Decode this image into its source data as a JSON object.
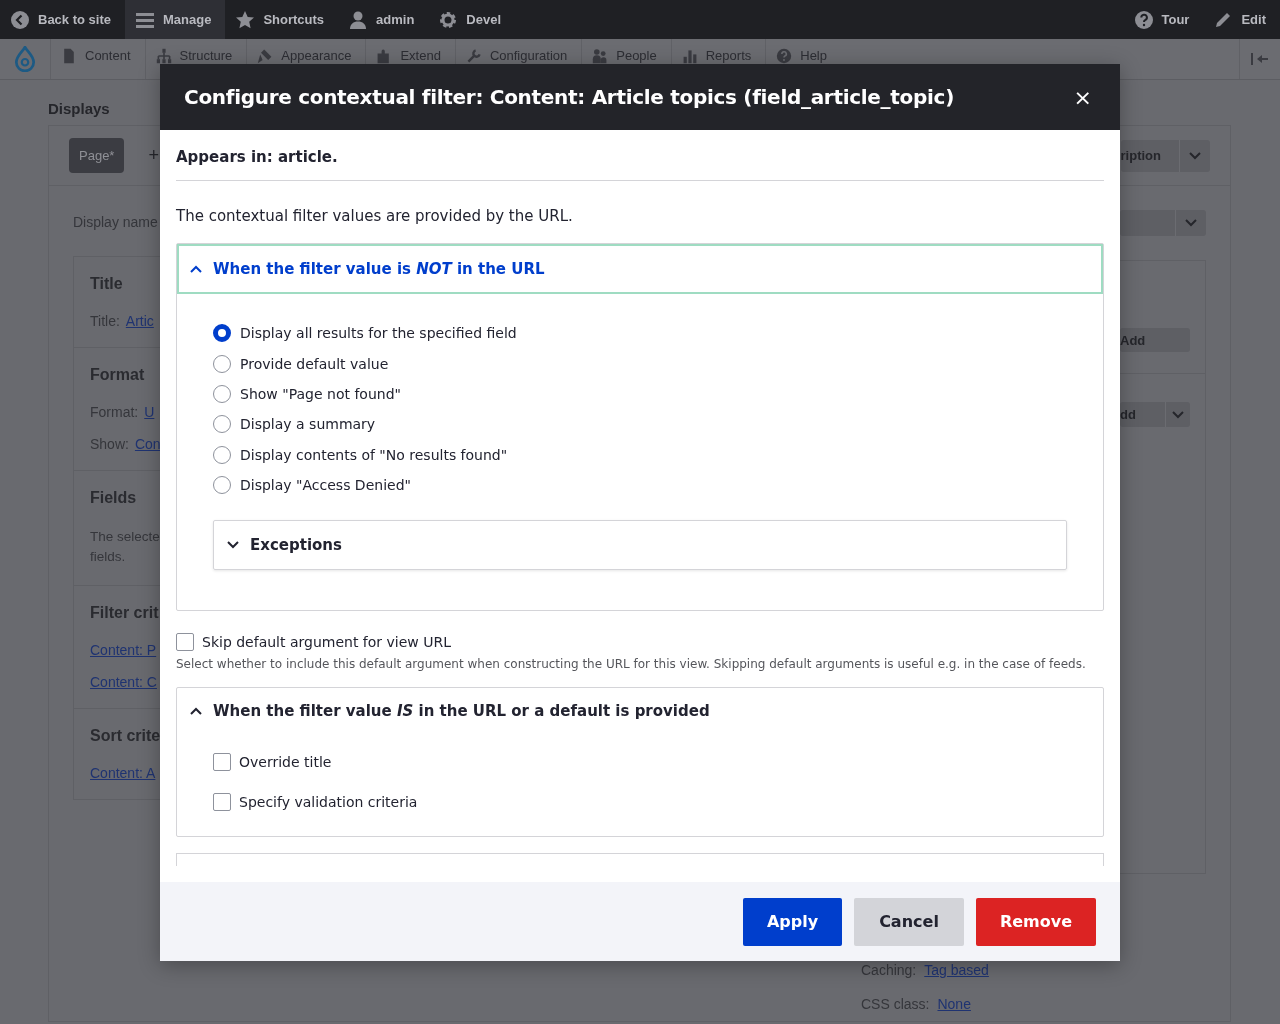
{
  "toolbar": {
    "left": [
      {
        "kind": "back",
        "label": "Back to site",
        "selected": false
      },
      {
        "kind": "menu",
        "label": "Manage",
        "selected": true
      },
      {
        "kind": "star",
        "label": "Shortcuts",
        "selected": false
      },
      {
        "kind": "user",
        "label": "admin",
        "selected": false
      },
      {
        "kind": "gear",
        "label": "Devel",
        "selected": false
      }
    ],
    "right": [
      {
        "kind": "help",
        "label": "Tour"
      },
      {
        "kind": "pencil",
        "label": "Edit"
      }
    ]
  },
  "admin_menu": {
    "items": [
      {
        "kind": "page",
        "label": "Content"
      },
      {
        "kind": "structure",
        "label": "Structure"
      },
      {
        "kind": "brush",
        "label": "Appearance"
      },
      {
        "kind": "puzzle",
        "label": "Extend"
      },
      {
        "kind": "wrench",
        "label": "Configuration"
      },
      {
        "kind": "people",
        "label": "People"
      },
      {
        "kind": "chart",
        "label": "Reports"
      },
      {
        "kind": "help",
        "label": "Help"
      }
    ]
  },
  "page": {
    "heading": "Displays",
    "display_tabs": [
      {
        "label": "Page*",
        "selected": true
      }
    ],
    "add_display": "+",
    "top_dropdown": "ription",
    "display_name_label": "Display name",
    "sections": [
      {
        "title": "Title",
        "lines": [
          {
            "label": "Title:",
            "link": "Artic"
          }
        ]
      },
      {
        "title": "Format",
        "lines": [
          {
            "label": "Format:",
            "link": "U"
          },
          {
            "label": "Show:",
            "link": "Con"
          }
        ]
      },
      {
        "title": "Fields",
        "text": "The selecte\nfields."
      },
      {
        "title": "Filter crit",
        "lines": [
          {
            "link": "Content: P"
          },
          {
            "link": "Content: C"
          }
        ]
      },
      {
        "title": "Sort crite",
        "lines": [
          {
            "link": "Content: A"
          }
        ]
      }
    ],
    "right_add_button": "Add",
    "right_dropdown": "dd",
    "settings": [
      {
        "label": "Caching:",
        "link": "Tag based"
      },
      {
        "label": "CSS class:",
        "link": "None"
      }
    ]
  },
  "dialog": {
    "title": "Configure contextual filter: Content: Article topics (field_article_topic)",
    "close": "×",
    "appears_in": "Appears in: article.",
    "intro": "The contextual filter values are provided by the URL.",
    "not_in_url": {
      "title": "When the filter value is *NOT* in the URL",
      "expanded": true,
      "focused": true,
      "options": [
        {
          "label": "Display all results for the specified field",
          "selected": true
        },
        {
          "label": "Provide default value",
          "selected": false
        },
        {
          "label": "Show \"Page not found\"",
          "selected": false
        },
        {
          "label": "Display a summary",
          "selected": false
        },
        {
          "label": "Display contents of \"No results found\"",
          "selected": false
        },
        {
          "label": "Display \"Access Denied\"",
          "selected": false
        }
      ],
      "exceptions": {
        "title": "Exceptions",
        "expanded": false
      }
    },
    "skip_default": {
      "label": "Skip default argument for view URL",
      "checked": false,
      "description": "Select whether to include this default argument when constructing the URL for this view. Skipping default arguments is useful e.g. in the case of feeds."
    },
    "in_url": {
      "title": "When the filter value *IS* in the URL or a default is provided",
      "expanded": true,
      "options": [
        {
          "label": "Override title",
          "checked": false
        },
        {
          "label": "Specify validation criteria",
          "checked": false
        }
      ]
    },
    "buttons": [
      {
        "kind": "primary",
        "label": "Apply"
      },
      {
        "kind": "secondary",
        "label": "Cancel"
      },
      {
        "kind": "danger",
        "label": "Remove"
      }
    ]
  }
}
